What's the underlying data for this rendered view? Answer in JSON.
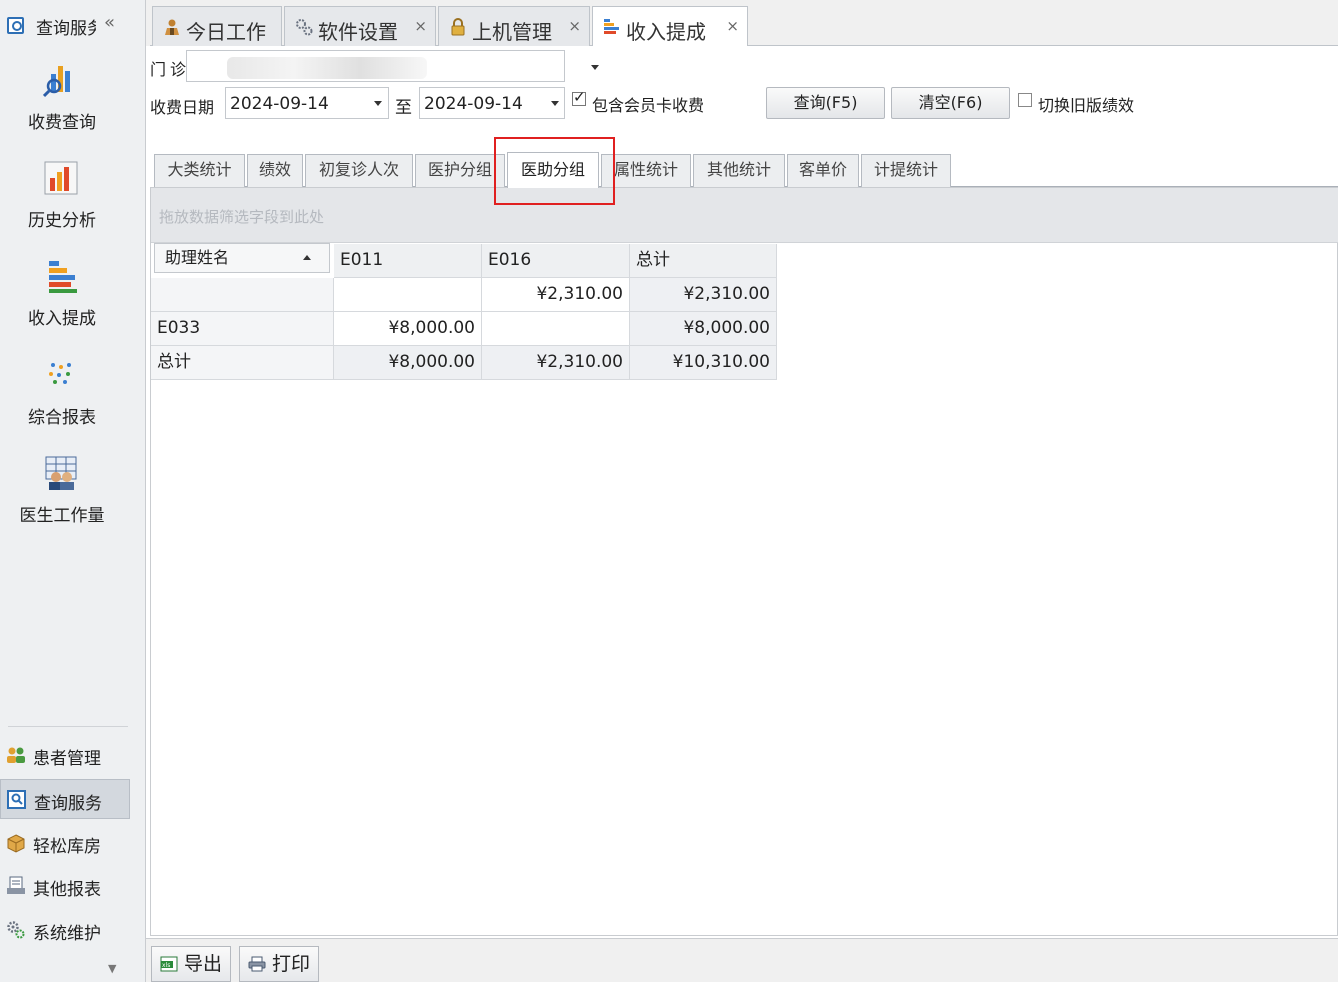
{
  "sidebar": {
    "header_title": "查询服务",
    "collapse_glyph": "«",
    "big_items": [
      {
        "label": "收费查询",
        "icon": "bar-chart-search-icon"
      },
      {
        "label": "历史分析",
        "icon": "history-chart-icon"
      },
      {
        "label": "收入提成",
        "icon": "income-bars-icon"
      },
      {
        "label": "综合报表",
        "icon": "dots-report-icon"
      },
      {
        "label": "医生工作量",
        "icon": "doctor-workload-icon"
      }
    ],
    "small_items": [
      {
        "label": "患者管理",
        "icon": "patients-icon"
      },
      {
        "label": "查询服务",
        "icon": "query-service-icon",
        "active": true
      },
      {
        "label": "轻松库房",
        "icon": "warehouse-icon"
      },
      {
        "label": "其他报表",
        "icon": "report-icon"
      },
      {
        "label": "系统维护",
        "icon": "gears-icon"
      }
    ]
  },
  "doc_tabs": [
    {
      "label": "今日工作",
      "icon": "work-icon",
      "closable": false
    },
    {
      "label": "软件设置",
      "icon": "settings-icon",
      "closable": true
    },
    {
      "label": "上机管理",
      "icon": "lock-icon",
      "closable": true
    },
    {
      "label": "收入提成",
      "icon": "income-bars-icon",
      "closable": true,
      "active": true
    }
  ],
  "close_glyph": "×",
  "filter": {
    "label": "门诊",
    "date_label": "收费日期",
    "date_from": "2024-09-14",
    "to_label": "至",
    "date_to": "2024-09-14",
    "include_member_card_label": "包含会员卡收费",
    "include_member_card_checked": true,
    "query_button": "查询(F5)",
    "clear_button": "清空(F6)",
    "switch_old_label": "切换旧版绩效",
    "switch_old_checked": false
  },
  "inner_tabs": [
    "大类统计",
    "绩效",
    "初复诊人次",
    "医护分组",
    "医助分组",
    "属性统计",
    "其他统计",
    "客单价",
    "计提统计"
  ],
  "inner_tab_active": "医助分组",
  "grid": {
    "drop_hint": "拖放数据筛选字段到此处",
    "row_field": "助理姓名",
    "columns": [
      "E011",
      "E016",
      "总计"
    ],
    "rows": [
      {
        "name": "",
        "values": [
          "",
          "¥2,310.00",
          "¥2,310.00"
        ]
      },
      {
        "name": "E033",
        "values": [
          "¥8,000.00",
          "",
          "¥8,000.00"
        ]
      },
      {
        "name": "总计",
        "values": [
          "¥8,000.00",
          "¥2,310.00",
          "¥10,310.00"
        ]
      }
    ]
  },
  "footer": {
    "export_label": "导出",
    "print_label": "打印"
  },
  "colors": {
    "highlight": "#e02020",
    "accent_blue": "#2d6fb5"
  }
}
